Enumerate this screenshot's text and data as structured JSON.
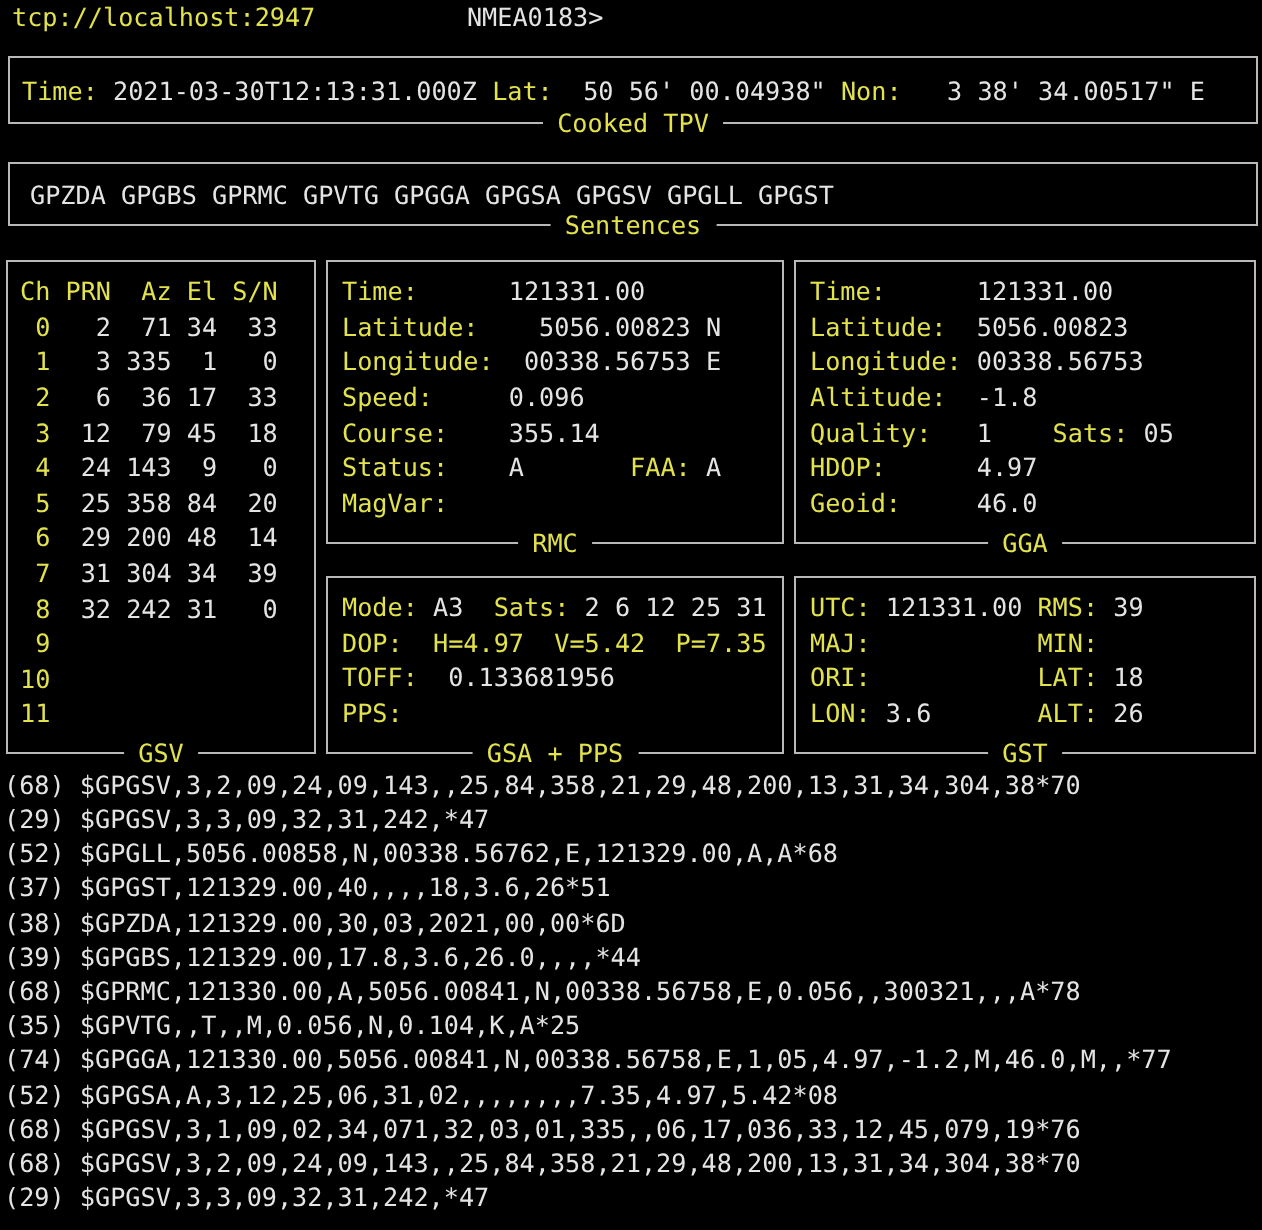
{
  "header": {
    "address": "tcp://localhost:2947",
    "prompt": "NMEA0183>"
  },
  "tpv": {
    "title": "Cooked TPV",
    "fields": [
      {
        "label": "Time:",
        "value": "2021-03-30T12:13:31.000Z"
      },
      {
        "label": "Lat:",
        "value": " 50 56' 00.04938\""
      },
      {
        "label": "Non:",
        "value": "  3 38' 34.00517\" E"
      }
    ]
  },
  "sentences": {
    "title": "Sentences",
    "items": [
      "GPZDA",
      "GPGBS",
      "GPRMC",
      "GPVTG",
      "GPGGA",
      "GPGSA",
      "GPGSV",
      "GPGLL",
      "GPGST"
    ]
  },
  "gsv": {
    "title": "GSV",
    "columns": [
      "Ch",
      "PRN",
      "Az",
      "El",
      "S/N"
    ],
    "rows": [
      {
        "ch": "0",
        "prn": "2",
        "az": "71",
        "el": "34",
        "sn": "33"
      },
      {
        "ch": "1",
        "prn": "3",
        "az": "335",
        "el": "1",
        "sn": "0"
      },
      {
        "ch": "2",
        "prn": "6",
        "az": "36",
        "el": "17",
        "sn": "33"
      },
      {
        "ch": "3",
        "prn": "12",
        "az": "79",
        "el": "45",
        "sn": "18"
      },
      {
        "ch": "4",
        "prn": "24",
        "az": "143",
        "el": "9",
        "sn": "0"
      },
      {
        "ch": "5",
        "prn": "25",
        "az": "358",
        "el": "84",
        "sn": "20"
      },
      {
        "ch": "6",
        "prn": "29",
        "az": "200",
        "el": "48",
        "sn": "14"
      },
      {
        "ch": "7",
        "prn": "31",
        "az": "304",
        "el": "34",
        "sn": "39"
      },
      {
        "ch": "8",
        "prn": "32",
        "az": "242",
        "el": "31",
        "sn": "0"
      },
      {
        "ch": "9"
      },
      {
        "ch": "10"
      },
      {
        "ch": "11"
      }
    ]
  },
  "rmc": {
    "title": "RMC",
    "rows": [
      {
        "label": "Time:",
        "value": "121331.00"
      },
      {
        "label": "Latitude:",
        "value": "  5056.00823 N"
      },
      {
        "label": "Longitude:",
        "value": " 00338.56753 E"
      },
      {
        "label": "Speed:",
        "value": "0.096"
      },
      {
        "label": "Course:",
        "value": "355.14"
      },
      {
        "label": "Status:",
        "value": "A",
        "label2": "FAA:",
        "value2": "A"
      },
      {
        "label": "MagVar:"
      }
    ]
  },
  "gga": {
    "title": "GGA",
    "rows": [
      {
        "label": "Time:",
        "value": "121331.00"
      },
      {
        "label": "Latitude:",
        "value": "5056.00823"
      },
      {
        "label": "Longitude:",
        "value": "00338.56753"
      },
      {
        "label": "Altitude:",
        "value": "-1.8"
      },
      {
        "label": "Quality:",
        "value": "1",
        "label2": "Sats:",
        "value2": "05"
      },
      {
        "label": "HDOP:",
        "value": "4.97"
      },
      {
        "label": "Geoid:",
        "value": "46.0"
      }
    ]
  },
  "gsa": {
    "title": "GSA + PPS",
    "rows": [
      {
        "label": "Mode:",
        "value": "A3",
        "label2": "Sats:",
        "value2": "2 6 12 25 31"
      },
      {
        "label": "DOP:",
        "extra": [
          "H=4.97",
          "V=5.42",
          "P=7.35"
        ]
      },
      {
        "label": "TOFF:",
        "value": " 0.133681956"
      },
      {
        "label": "PPS:"
      }
    ]
  },
  "gst": {
    "title": "GST",
    "rows": [
      {
        "label": "UTC:",
        "value": "121331.00",
        "label2": "RMS:",
        "value2": "39"
      },
      {
        "label": "MAJ:",
        "label2": "MIN:"
      },
      {
        "label": "ORI:",
        "label2": "LAT:",
        "value2": "18"
      },
      {
        "label": "LON:",
        "value": "3.6",
        "label2": "ALT:",
        "value2": "26"
      }
    ]
  },
  "log": [
    "(68) $GPGSV,3,2,09,24,09,143,,25,84,358,21,29,48,200,13,31,34,304,38*70",
    "(29) $GPGSV,3,3,09,32,31,242,*47",
    "(52) $GPGLL,5056.00858,N,00338.56762,E,121329.00,A,A*68",
    "(37) $GPGST,121329.00,40,,,,18,3.6,26*51",
    "(38) $GPZDA,121329.00,30,03,2021,00,00*6D",
    "(39) $GPGBS,121329.00,17.8,3.6,26.0,,,,*44",
    "(68) $GPRMC,121330.00,A,5056.00841,N,00338.56758,E,0.056,,300321,,,A*78",
    "(35) $GPVTG,,T,,M,0.056,N,0.104,K,A*25",
    "(74) $GPGGA,121330.00,5056.00841,N,00338.56758,E,1,05,4.97,-1.2,M,46.0,M,,*77",
    "(52) $GPGSA,A,3,12,25,06,31,02,,,,,,,,7.35,4.97,5.42*08",
    "(68) $GPGSV,3,1,09,02,34,071,32,03,01,335,,06,17,036,33,12,45,079,19*76",
    "(68) $GPGSV,3,2,09,24,09,143,,25,84,358,21,29,48,200,13,31,34,304,38*70",
    "(29) $GPGSV,3,3,09,32,31,242,*47"
  ]
}
